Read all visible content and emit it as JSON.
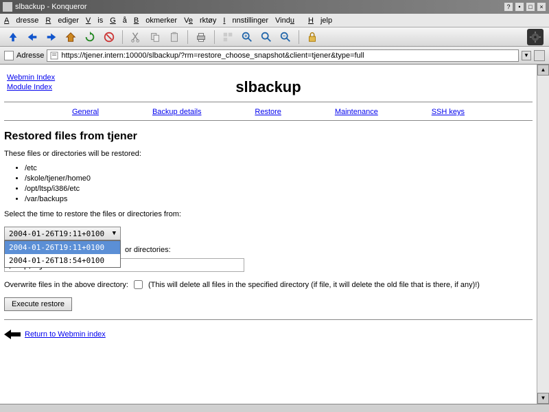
{
  "window": {
    "title": "slbackup - Konqueror"
  },
  "menubar": {
    "items": [
      "Adresse",
      "Rediger",
      "Vis",
      "Gå",
      "Bokmerker",
      "Verktøy",
      "Innstillinger",
      "Vindu",
      "Hjelp"
    ]
  },
  "url": {
    "label": "Adresse",
    "value": "https://tjener.intern:10000/slbackup/?rm=restore_choose_snapshot&client=tjener&type=full"
  },
  "nav": {
    "webmin_index": "Webmin Index",
    "module_index": "Module Index"
  },
  "page_title": "slbackup",
  "tabs": {
    "general": "General",
    "backup_details": "Backup details",
    "restore": "Restore",
    "maintenance": "Maintenance",
    "ssh_keys": "SSH keys"
  },
  "section_heading": "Restored files from tjener",
  "intro_text": "These files or directories will be restored:",
  "files": [
    "/etc",
    "/skole/tjener/home0",
    "/opt/ltsp/i386/etc",
    "/var/backups"
  ],
  "select_label": "Select the time to restore the files or directories from:",
  "snapshot_select": {
    "selected": "2004-01-26T19:11+0100",
    "options": [
      "2004-01-26T19:11+0100",
      "2004-01-26T18:54+0100"
    ]
  },
  "dest_label_fragment": "or directories:",
  "dest_value": "/tmp/tjener",
  "overwrite": {
    "label_before": "Overwrite files in the above directory:",
    "label_after": "(This will delete all files in the specified directory (if file, it will delete the old file that is there, if any)!)",
    "checked": false
  },
  "execute_button": "Execute restore",
  "return_link": "Return to Webmin index"
}
